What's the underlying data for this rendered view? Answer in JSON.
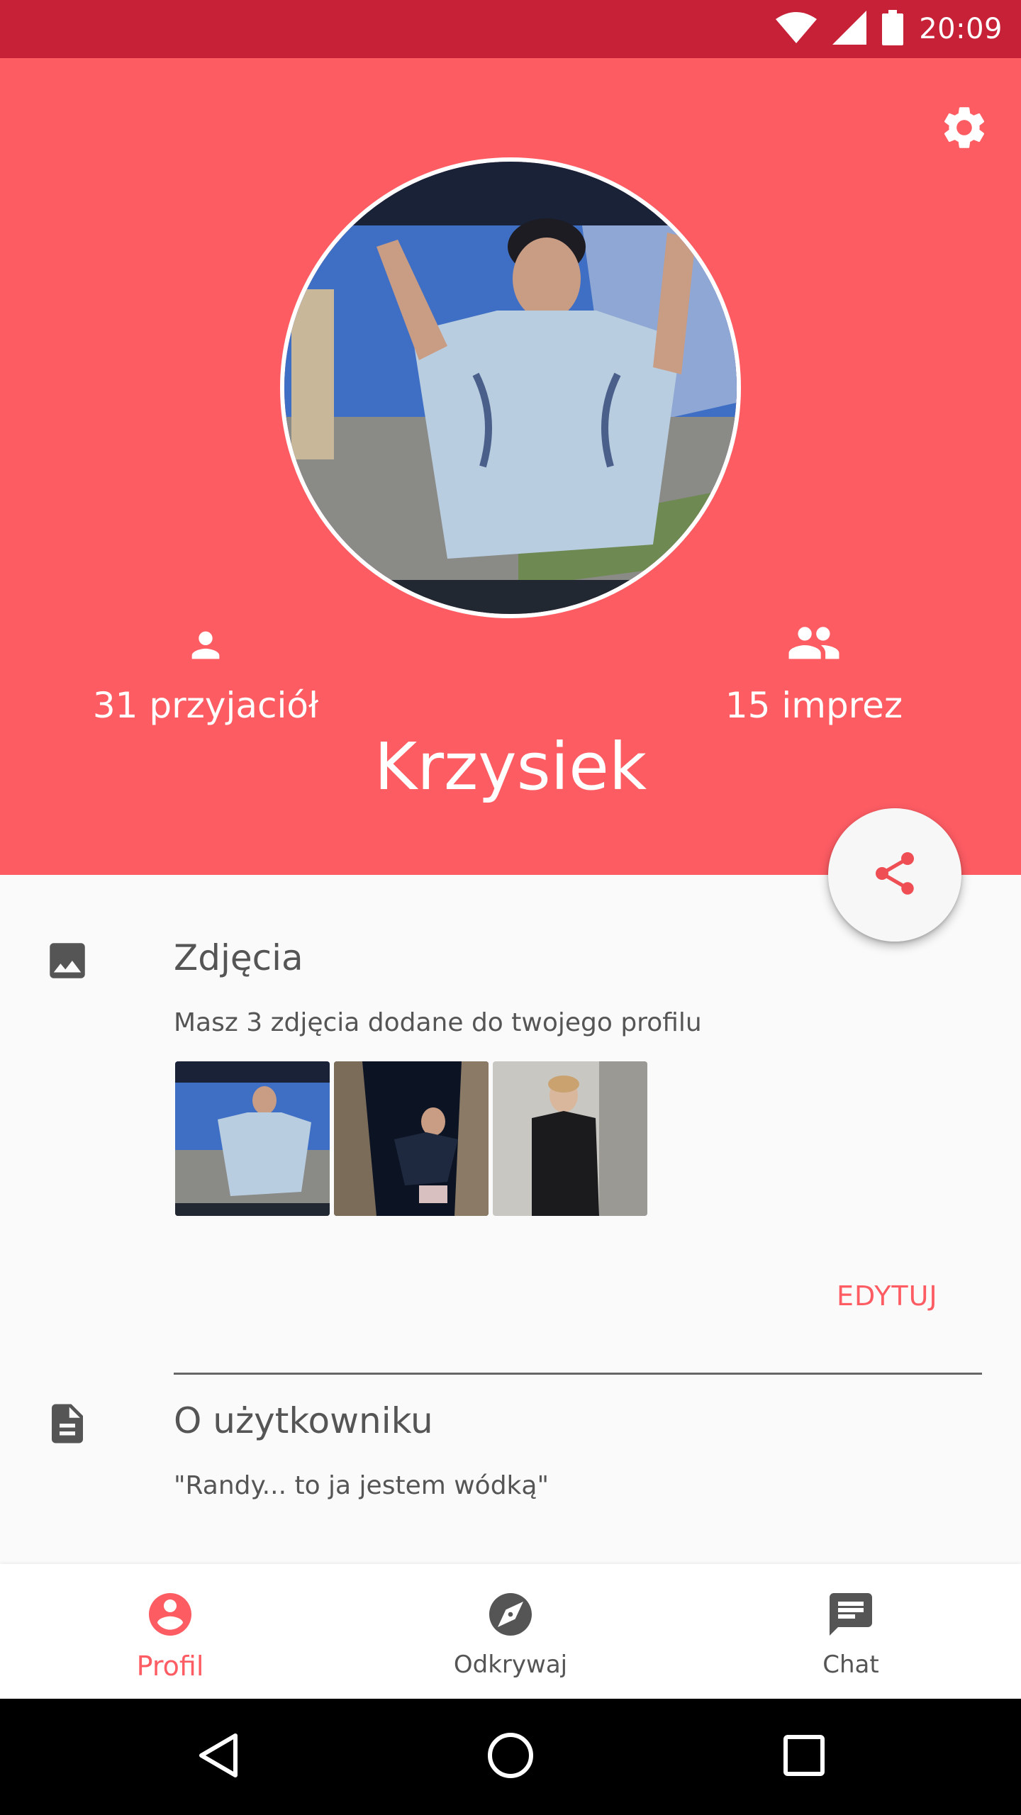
{
  "status_bar": {
    "time": "20:09",
    "icons": [
      "wifi-icon",
      "signal-icon",
      "battery-icon"
    ]
  },
  "header": {
    "settings_icon": "gear-icon",
    "username": "Krzysiek",
    "stats": [
      {
        "icon": "person-icon",
        "label": "31 przyjaciół"
      },
      {
        "icon": "people-icon",
        "label": "15 imprez"
      }
    ],
    "background_color": "#fd5c63"
  },
  "share_button": {
    "icon": "share-icon"
  },
  "photos_section": {
    "icon": "image-icon",
    "title": "Zdjęcia",
    "description": "Masz 3 zdjęcia dodane do twojego profilu",
    "thumbnail_count": 3,
    "edit_label": "EDYTUJ"
  },
  "about_section": {
    "icon": "document-icon",
    "title": "O użytkowniku",
    "text": "\"Randy... to ja jestem wódką\""
  },
  "bottom_nav": {
    "items": [
      {
        "label": "Profil",
        "icon": "account-circle-icon",
        "active": true
      },
      {
        "label": "Odkrywaj",
        "icon": "compass-icon",
        "active": false
      },
      {
        "label": "Chat",
        "icon": "chat-icon",
        "active": false
      }
    ]
  },
  "system_nav": {
    "buttons": [
      "back-icon",
      "home-icon",
      "recents-icon"
    ]
  },
  "colors": {
    "accent": "#fd5c63",
    "status_bar": "#c72138"
  }
}
